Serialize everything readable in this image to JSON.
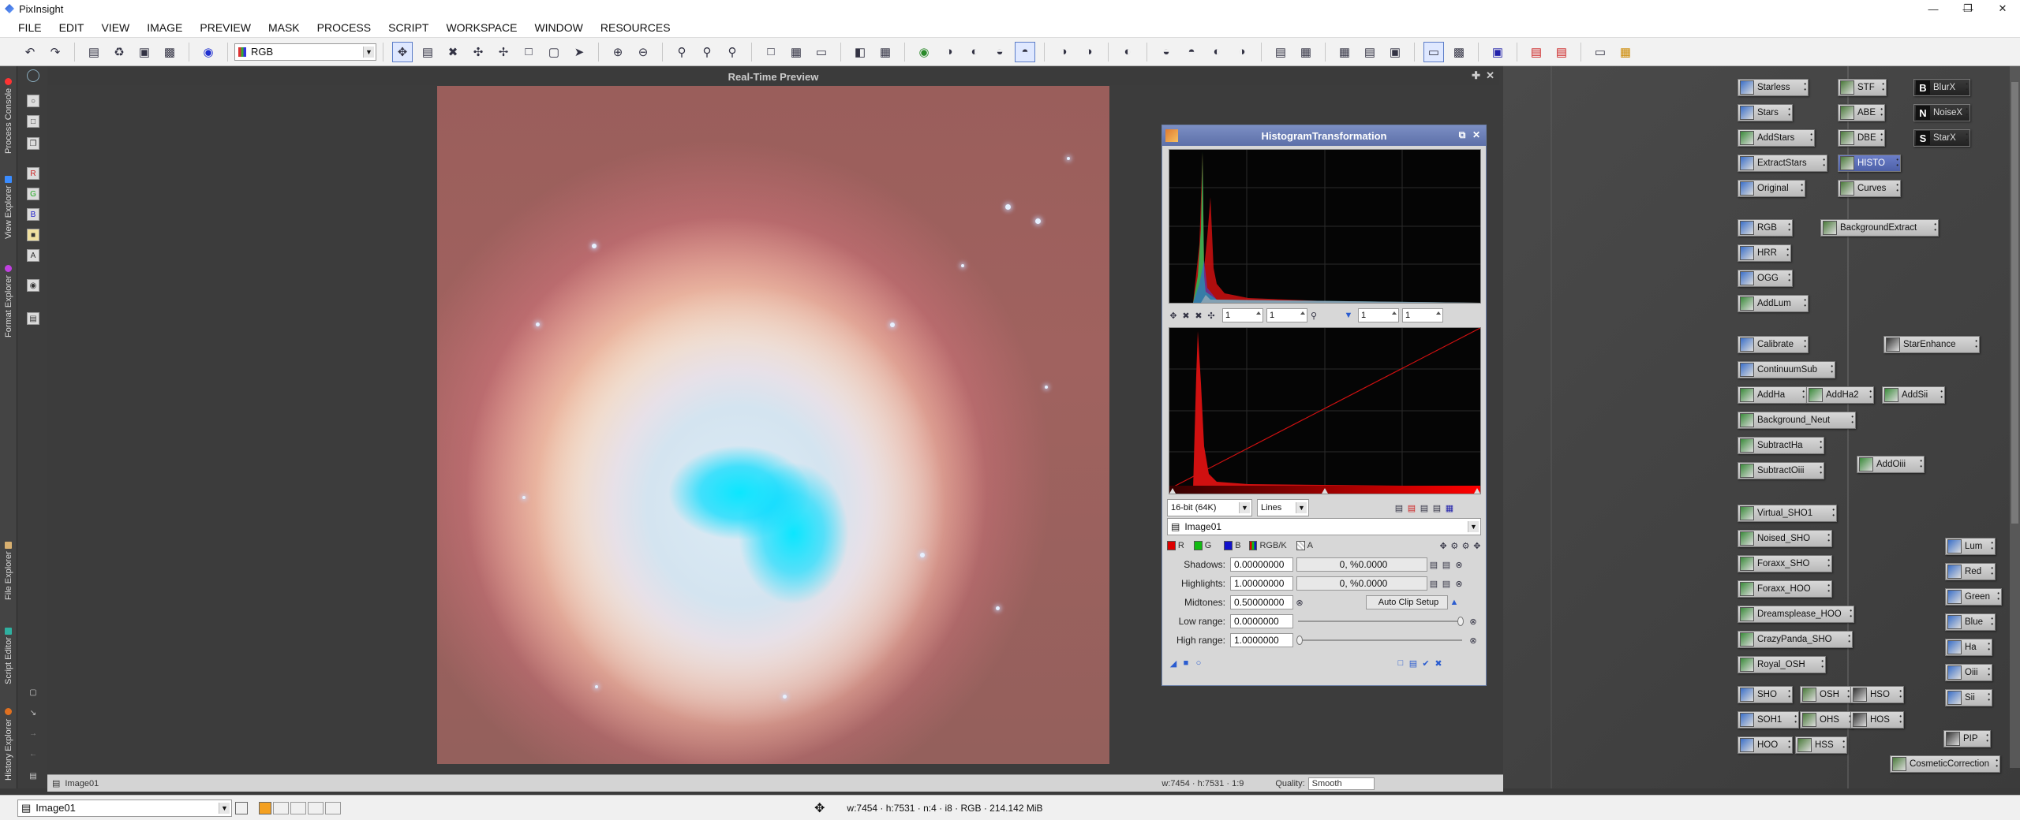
{
  "window": {
    "title": "PixInsight"
  },
  "menu": [
    "FILE",
    "EDIT",
    "VIEW",
    "IMAGE",
    "PREVIEW",
    "MASK",
    "PROCESS",
    "SCRIPT",
    "WORKSPACE",
    "WINDOW",
    "RESOURCES"
  ],
  "toolbar": {
    "channel_combo": "RGB"
  },
  "left_tabs": [
    "Process Console",
    "View Explorer",
    "Format Explorer",
    "File Explorer",
    "Script Editor",
    "History Explorer"
  ],
  "preview": {
    "title": "Real-Time Preview"
  },
  "histogram": {
    "title": "HistogramTransformation",
    "zoom_h1": "1",
    "zoom_v1": "1",
    "zoom_h2": "1",
    "zoom_v2": "1",
    "resolution": "16-bit (64K)",
    "graph_style": "Lines",
    "view": "Image01",
    "channels": [
      "R",
      "G",
      "B",
      "RGB/K",
      "A"
    ],
    "shadows_label": "Shadows:",
    "shadows": "0.00000000",
    "shadows_stat": "0, %0.0000",
    "highlights_label": "Highlights:",
    "highlights": "1.00000000",
    "highlights_stat": "0, %0.0000",
    "midtones_label": "Midtones:",
    "midtones": "0.50000000",
    "auto_clip": "Auto Clip Setup",
    "low_range_label": "Low range:",
    "low_range": "0.0000000",
    "high_range_label": "High range:",
    "high_range": "1.0000000"
  },
  "image_window": {
    "title": "Image01",
    "dims": "w:7454 · h:7531 · 1:9",
    "quality_label": "Quality:",
    "quality": "Smooth"
  },
  "status": {
    "view": "Image01",
    "info": "w:7454 · h:7531 · n:4 · i8 · RGB · 214.142 MiB"
  },
  "icons": {
    "col1": [
      "Starless",
      "Stars",
      "AddStars",
      "ExtractStars",
      "Original",
      "RGB",
      "HRR",
      "OGG",
      "AddLum",
      "Calibrate",
      "ContinuumSub",
      "AddHa",
      "Background_Neut",
      "SubtractHa",
      "SubtractOiii",
      "Virtual_SHO1",
      "Noised_SHO",
      "Foraxx_SHO",
      "Foraxx_HOO",
      "Dreamsplease_HOO",
      "CrazyPanda_SHO",
      "Royal_OSH",
      "SHO",
      "SOH1",
      "HOO"
    ],
    "col2": [
      "STF",
      "ABE",
      "DBE",
      "HISTO",
      "Curves",
      "BackgroundExtract",
      "AddHa2",
      "AddOiii",
      "OSH",
      "OHS",
      "HSS",
      "CosmeticCorrection"
    ],
    "col3": [
      "BlurX",
      "NoiseX",
      "StarX",
      "StarEnhance",
      "AddSii",
      "HSO",
      "HOS",
      "PIP"
    ],
    "col4": [
      "Lum",
      "Red",
      "Green",
      "Blue",
      "Ha",
      "Oiii",
      "Sii"
    ]
  },
  "colors": {
    "accent": "#5c6fa8",
    "hist_red": "#d01010",
    "hist_green": "#20d060"
  }
}
